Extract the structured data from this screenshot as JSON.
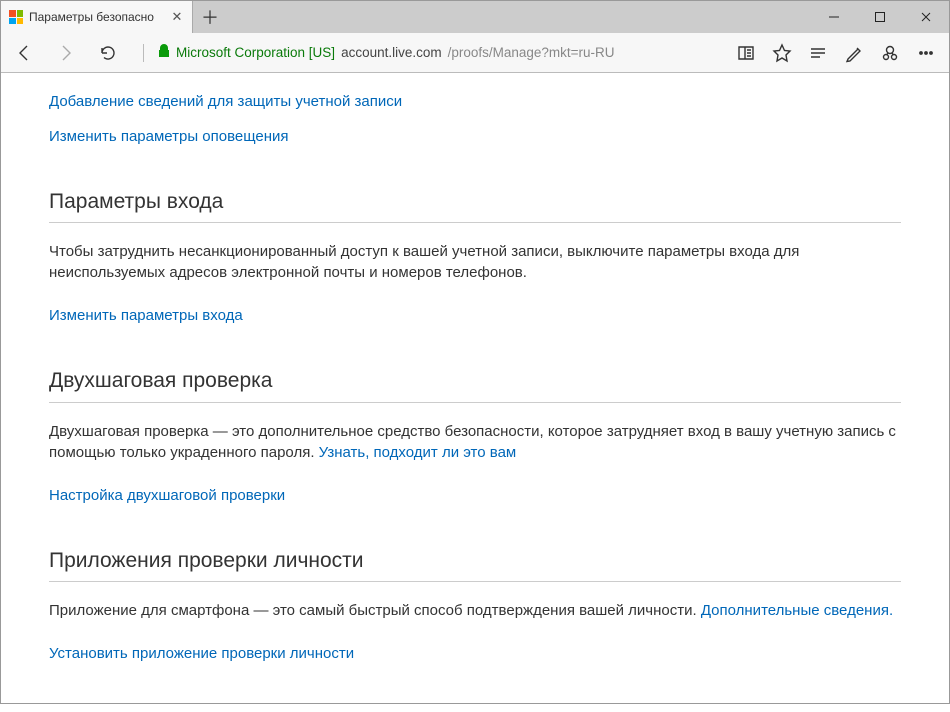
{
  "window": {
    "tabTitle": "Параметры безопасно"
  },
  "address": {
    "cert": "Microsoft Corporation [US]",
    "host": "account.live.com",
    "path": "/proofs/Manage?mkt=ru-RU"
  },
  "topLinks": {
    "addInfo": "Добавление сведений для защиты учетной записи",
    "changeAlerts": "Изменить параметры оповещения"
  },
  "signin": {
    "heading": "Параметры входа",
    "body": "Чтобы затруднить несанкционированный доступ к вашей учетной записи, выключите параметры входа для неиспользуемых адресов электронной почты и номеров телефонов.",
    "link": "Изменить параметры входа"
  },
  "twostep": {
    "heading": "Двухшаговая проверка",
    "body1": "Двухшаговая проверка — это дополнительное средство безопасности, которое затрудняет вход в вашу учетную запись с помощью только украденного пароля. ",
    "learn": "Узнать, подходит ли это вам",
    "link": "Настройка двухшаговой проверки"
  },
  "idapp": {
    "heading": "Приложения проверки личности",
    "body1": "Приложение для смартфона — это самый быстрый способ подтверждения вашей личности. ",
    "more": "Дополнительные сведения.",
    "link": "Установить приложение проверки личности"
  }
}
